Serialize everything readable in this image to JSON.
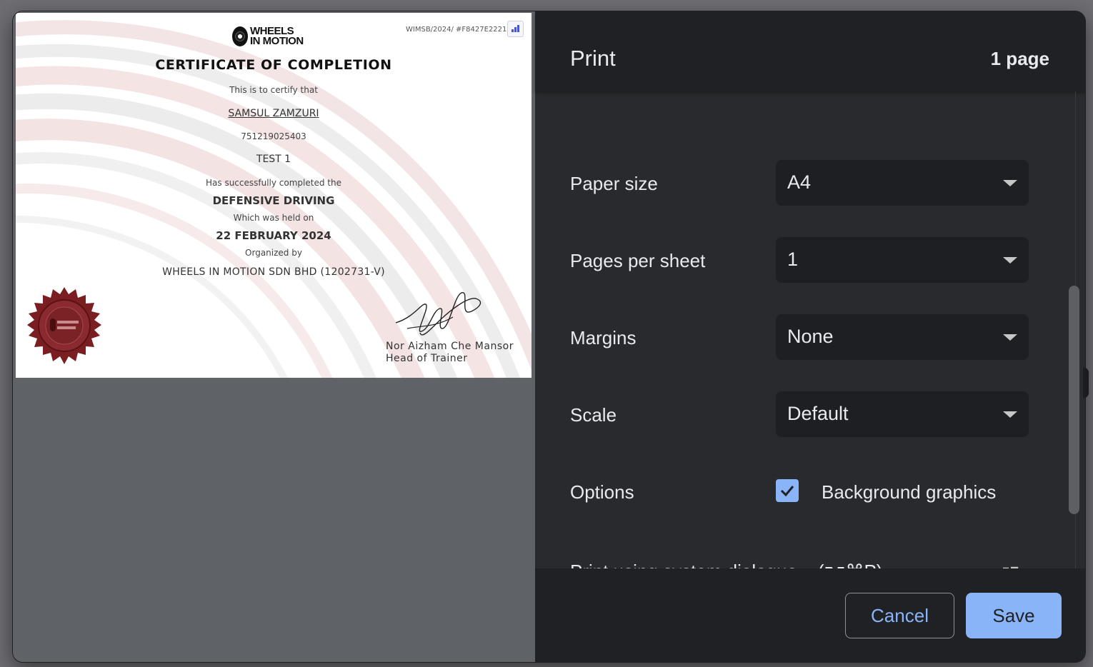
{
  "certificate": {
    "logo_line1": "WHEELS",
    "logo_line2": "IN MOTION",
    "reference": "WIMSB/2024/ #F8427E2221",
    "title": "CERTIFICATE OF COMPLETION",
    "certify_text": "This is to certify that",
    "recipient": "SAMSUL ZAMZURI",
    "id_number": "751219025403",
    "test_name": "TEST 1",
    "completed_text": "Has successfully completed the",
    "course": "DEFENSIVE DRIVING",
    "held_text": "Which was held on",
    "date": "22 FEBRUARY 2024",
    "organized_text": "Organized by",
    "organizer": "WHEELS IN MOTION SDN BHD (1202731-V)",
    "signer_name": "Nor Aizham Che Mansor",
    "signer_title": "Head of Trainer",
    "seal_text": "WHEELS IN MOTION"
  },
  "panel": {
    "title": "Print",
    "page_count": "1 page",
    "paper_size": {
      "label": "Paper size",
      "value": "A4"
    },
    "pages_per_sheet": {
      "label": "Pages per sheet",
      "value": "1"
    },
    "margins": {
      "label": "Margins",
      "value": "None"
    },
    "scale": {
      "label": "Scale",
      "value": "Default"
    },
    "options": {
      "label": "Options",
      "background_graphics_label": "Background graphics",
      "background_graphics_checked": true
    },
    "system_dialog_label": "Print using system dialogue... (⌥⌘P)"
  },
  "footer": {
    "cancel_label": "Cancel",
    "save_label": "Save"
  },
  "colors": {
    "accent": "#8ab4f8",
    "panel_bg": "#292a2d",
    "header_bg": "#202124",
    "preview_bg": "#5f6368"
  }
}
